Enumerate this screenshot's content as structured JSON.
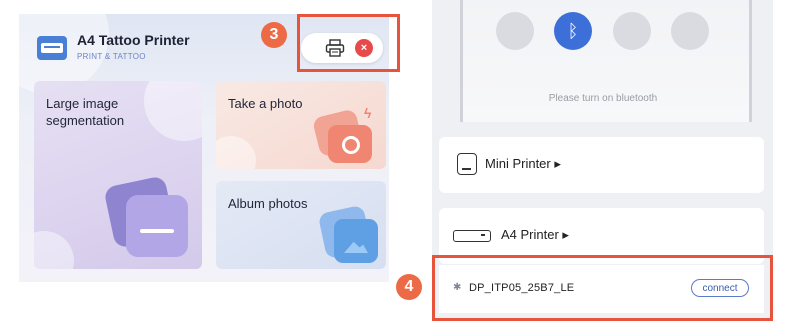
{
  "app": {
    "title": "A4 Tattoo Printer",
    "subtitle": "PRINT & TATTOO"
  },
  "header_controls": {
    "printer_icon": "printer-icon",
    "close_icon": "close-icon",
    "close_symbol": "×"
  },
  "cards": {
    "large_image_segmentation": "Large image\nsegmentation",
    "take_photo": "Take a photo",
    "album_photos": "Album photos"
  },
  "bluetooth": {
    "symbol": "ᛒ",
    "message": "Please turn on bluetooth"
  },
  "printers": [
    {
      "label": "Mini Printer ▸",
      "icon": "mini-printer-icon"
    },
    {
      "label": "A4 Printer ▸",
      "icon": "a4-printer-icon"
    }
  ],
  "device": {
    "bt_symbol": "✱",
    "name": "DP_ITP05_25B7_LE",
    "connect_label": "connect"
  },
  "annotations": {
    "step3": "3",
    "step4": "4"
  },
  "colors": {
    "highlight": "#e8533c",
    "badge": "#ec6a45",
    "bluetooth_active": "#3d6fd8",
    "close_red": "#e74a4a",
    "connect_blue": "#3a5cae"
  }
}
